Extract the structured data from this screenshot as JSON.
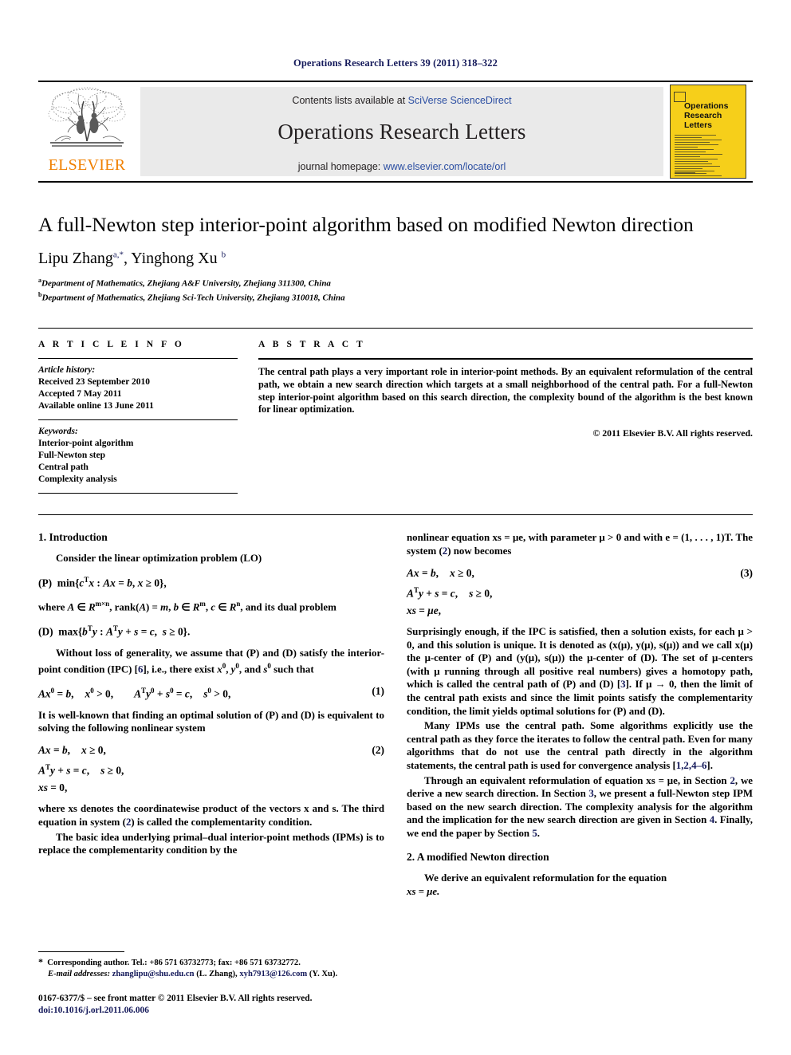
{
  "running_head": "Operations Research Letters 39 (2011) 318–322",
  "masthead": {
    "publisher_wordmark": "ELSEVIER",
    "contents_prefix": "Contents lists available at ",
    "contents_link": "SciVerse ScienceDirect",
    "journal_title": "Operations Research Letters",
    "homepage_prefix": "journal homepage: ",
    "homepage_link": "www.elsevier.com/locate/orl",
    "cover_title_line1": "Operations",
    "cover_title_line2": "Research",
    "cover_title_line3": "Letters",
    "accent_orange": "#f08000",
    "link_blue": "#2b4ea2",
    "cover_yellow": "#f6cf1a"
  },
  "title_block": {
    "title": "A full-Newton step interior-point algorithm based on modified Newton direction",
    "author1": "Lipu Zhang",
    "author1_sup": "a,*",
    "author_sep": ", ",
    "author2": "Yinghong Xu",
    "author2_sup": "b",
    "affiliation_a_marker": "a",
    "affiliation_a": "Department of Mathematics, Zhejiang A&F University, Zhejiang 311300, China",
    "affiliation_b_marker": "b",
    "affiliation_b": "Department of Mathematics, Zhejiang Sci-Tech University, Zhejiang 310018, China"
  },
  "article_info": {
    "heading": "A R T I C L E    I N F O",
    "history_label": "Article history:",
    "received": "Received 23 September 2010",
    "accepted": "Accepted 7 May 2011",
    "available": "Available online 13 June 2011",
    "keywords_label": "Keywords:",
    "keywords": [
      "Interior-point algorithm",
      "Full-Newton step",
      "Central path",
      "Complexity analysis"
    ]
  },
  "abstract": {
    "heading": "A B S T R A C T",
    "text": "The central path plays a very important role in interior-point methods. By an equivalent reformulation of the central path, we obtain a new search direction which targets at a small neighborhood of the central path. For a full-Newton step interior-point algorithm based on this search direction, the complexity bound of the algorithm is the best known for linear optimization.",
    "copyright": "© 2011 Elsevier B.V. All rights reserved."
  },
  "sections": {
    "intro_heading": "1. Introduction",
    "modified_newton_heading": "2. A modified Newton direction"
  },
  "left_column": {
    "p1": "Consider the linear optimization problem (LO)",
    "eq_P": "(P)  min{cTx : Ax = b, x ≥ 0},",
    "p2": "where A ∈ Rm×n, rank(A) = m, b ∈ Rm, c ∈ Rn, and its dual problem",
    "eq_D": "(D)  max{bTy : ATy + s = c,  s ≥ 0}.",
    "p3_a": "Without loss of generality, we assume that (P) and (D) satisfy the interior-point condition (IPC) [",
    "p3_ref": "6",
    "p3_b": "], i.e., there exist x0, y0, and s0 such that",
    "eq1_body": "Ax0 = b,   x0 > 0,        ATy0 + s0 = c,   s0 > 0,",
    "eq1_num": "(1)",
    "p4": "It is well-known that finding an optimal solution of (P) and (D) is equivalent to solving the following nonlinear system",
    "eq2_l1": "Ax = b,   x ≥ 0,",
    "eq2_l2": "ATy + s = c,   s ≥ 0,",
    "eq2_l3": "xs = 0,",
    "eq2_num": "(2)",
    "p5_a": "where xs denotes the coordinatewise product of the vectors x and s. The third equation in system (",
    "p5_ref": "2",
    "p5_b": ") is called the complementarity condition.",
    "p6": "The basic idea underlying primal–dual interior-point methods (IPMs) is to replace the complementarity condition by the"
  },
  "right_column": {
    "p1_a": "nonlinear equation xs = μe, with parameter μ > 0 and with e = (1, . . . , 1)T. The system (",
    "p1_ref": "2",
    "p1_b": ") now becomes",
    "eq3_l1": "Ax = b,   x ≥ 0,",
    "eq3_l2": "ATy + s = c,   s ≥ 0,",
    "eq3_l3": "xs = μe,",
    "eq3_num": "(3)",
    "p2_a": "Surprisingly enough, if the IPC is satisfied, then a solution exists, for each μ > 0, and this solution is unique. It is denoted as (x(μ), y(μ), s(μ)) and we call x(μ) the μ-center of (P) and (y(μ), s(μ)) the μ-center of (D). The set of μ-centers (with μ running through all positive real numbers) gives a homotopy path, which is called the central path of (P) and (D) [",
    "p2_ref": "3",
    "p2_b": "]. If μ → 0, then the limit of the central path exists and since the limit points satisfy the complementarity condition, the limit yields optimal solutions for (P) and (D).",
    "p3_a": "Many IPMs use the central path. Some algorithms explicitly use the central path as they force the iterates to follow the central path. Even for many algorithms that do not use the central path directly in the algorithm statements, the central path is used for convergence analysis [",
    "p3_ref": "1,2,4–6",
    "p3_b": "].",
    "p4_a": "Through an equivalent reformulation of equation xs = μe, in Section ",
    "p4_ref1": "2",
    "p4_b": ", we derive a new search direction. In Section ",
    "p4_ref2": "3",
    "p4_c": ", we present a full-Newton step IPM based on the new search direction. The complexity analysis for the algorithm and the implication for the new search direction are given in Section ",
    "p4_ref3": "4",
    "p4_d": ". Finally, we end the paper by Section ",
    "p4_ref4": "5",
    "p4_e": ".",
    "p5_a": "We derive an equivalent reformulation for the equation ",
    "p5_b": "xs = μe."
  },
  "footnotes": {
    "star": "*",
    "corresponding": "Corresponding author. Tel.: +86 571 63732773; fax: +86 571 63732772.",
    "email_label": "E-mail addresses:",
    "email1": "zhanglipu@shu.edu.cn",
    "email1_owner": "(L. Zhang),",
    "email2": "xyh7913@126.com",
    "email2_owner": "(Y. Xu).",
    "issn_line": "0167-6377/$ – see front matter © 2011 Elsevier B.V. All rights reserved.",
    "doi": "doi:10.1016/j.orl.2011.06.006"
  }
}
